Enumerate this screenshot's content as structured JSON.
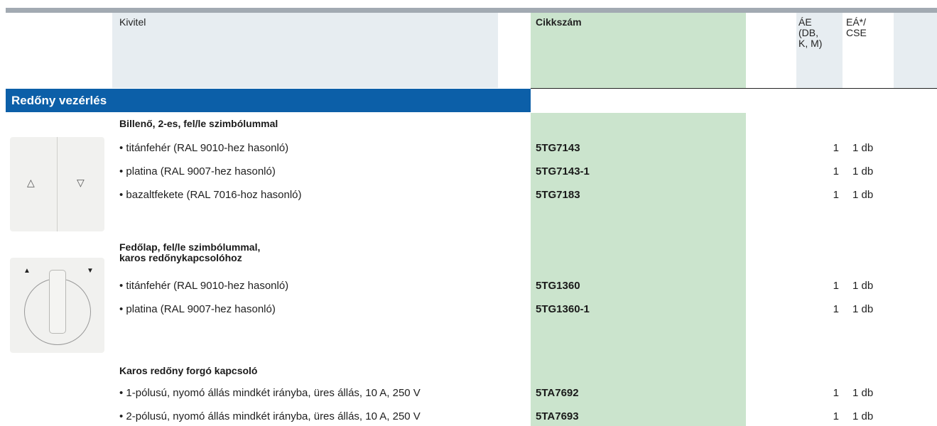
{
  "header": {
    "kivitel": "Kivitel",
    "cikkszam": "Cikkszám",
    "ae": [
      "ÁE",
      "(DB,",
      "K, M)"
    ],
    "ea": [
      "EÁ*/",
      "CSE"
    ]
  },
  "section_title": "Redőny vezérlés",
  "groups": [
    {
      "title": "Billenő, 2-es, fel/le szimbólummal",
      "rows": [
        {
          "desc": "• titánfehér (RAL 9010-hez hasonló)",
          "code": "5TG7143",
          "ae": "1",
          "ea": "1 db"
        },
        {
          "desc": "• platina (RAL 9007-hez hasonló)",
          "code": "5TG7143-1",
          "ae": "1",
          "ea": "1 db"
        },
        {
          "desc": "• bazaltfekete (RAL 7016-hoz hasonló)",
          "code": "5TG7183",
          "ae": "1",
          "ea": "1 db"
        }
      ]
    },
    {
      "title": "Fedőlap, fel/le szimbólummal,",
      "title2": "karos redőnykapcsolóhoz",
      "rows": [
        {
          "desc": "• titánfehér (RAL 9010-hez hasonló)",
          "code": "5TG1360",
          "ae": "1",
          "ea": "1 db"
        },
        {
          "desc": "• platina (RAL 9007-hez hasonló)",
          "code": "5TG1360-1",
          "ae": "1",
          "ea": "1 db"
        }
      ]
    },
    {
      "title": "Karos redőny forgó kapcsoló",
      "rows": [
        {
          "desc": "• 1-pólusú, nyomó állás mindkét irányba, üres állás, 10 A, 250 V",
          "code": "5TA7692",
          "ae": "1",
          "ea": "1 db"
        },
        {
          "desc": "• 2-pólusú, nyomó állás mindkét irányba, üres állás, 10 A, 250 V",
          "code": "5TA7693",
          "ae": "1",
          "ea": "1 db"
        }
      ]
    }
  ],
  "icons": {
    "rocker_up": "△",
    "rocker_down": "▽",
    "dial_up": "▲",
    "dial_down": "▼"
  }
}
